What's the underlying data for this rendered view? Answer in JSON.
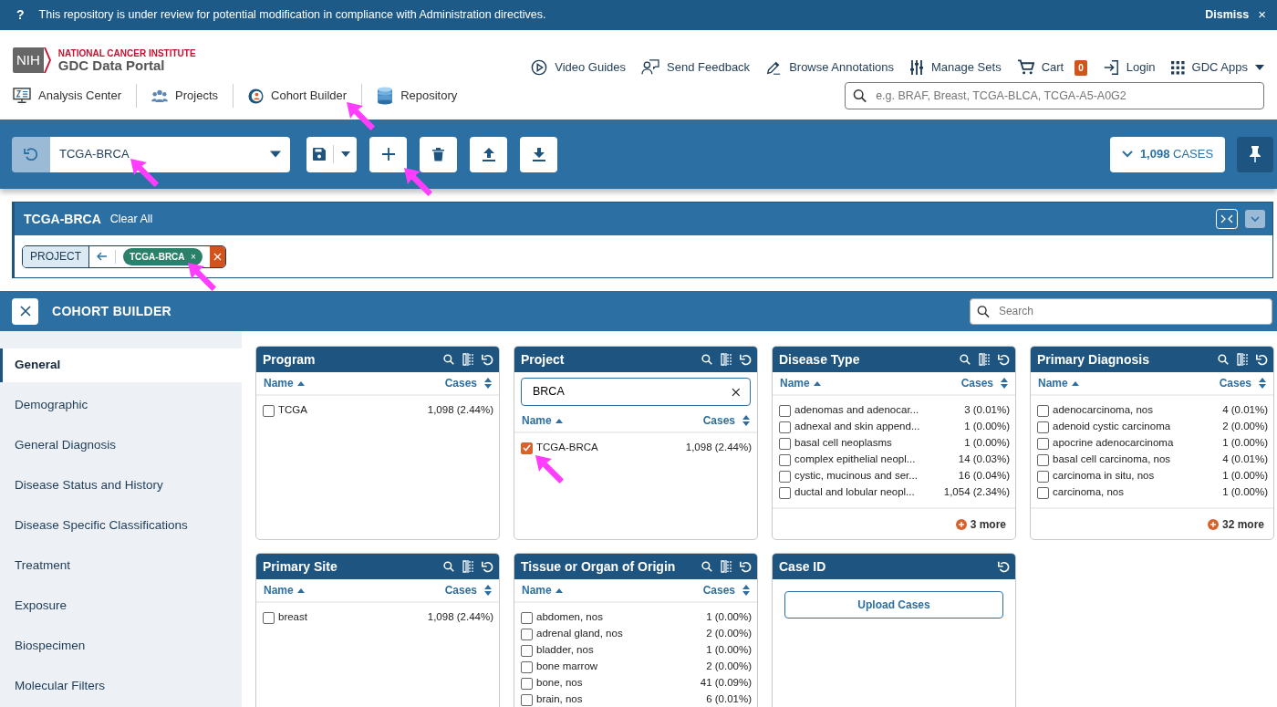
{
  "banner": {
    "icon": "?",
    "message": "This repository is under review for potential modification in compliance with Administration directives.",
    "dismiss": "Dismiss",
    "close": "×"
  },
  "logo": {
    "badge": "NIH",
    "institute": "NATIONAL CANCER INSTITUTE",
    "portal": "GDC Data Portal"
  },
  "top_links": [
    {
      "label": "Video Guides"
    },
    {
      "label": "Send Feedback"
    },
    {
      "label": "Browse Annotations"
    },
    {
      "label": "Manage Sets"
    },
    {
      "label": "Cart",
      "badge": "0"
    },
    {
      "label": "Login"
    },
    {
      "label": "GDC Apps"
    }
  ],
  "nav": [
    {
      "label": "Analysis Center"
    },
    {
      "label": "Projects"
    },
    {
      "label": "Cohort Builder"
    },
    {
      "label": "Repository"
    }
  ],
  "search": {
    "placeholder": "e.g. BRAF, Breast, TCGA-BLCA, TCGA-A5-A0G2"
  },
  "cohort_bar": {
    "name": "TCGA-BRCA",
    "cases_count": "1,098",
    "cases_label": "CASES"
  },
  "cohort_filters": {
    "title": "TCGA-BRCA",
    "clear": "Clear All",
    "filters": [
      {
        "field": "PROJECT",
        "values": [
          {
            "label": "TCGA-BRCA",
            "remove": "×"
          }
        ]
      }
    ]
  },
  "builder": {
    "title": "COHORT BUILDER",
    "search_placeholder": "Search",
    "tabs": [
      {
        "label": "General",
        "selected": true
      },
      {
        "label": "Demographic",
        "selected": false
      },
      {
        "label": "General Diagnosis",
        "selected": false
      },
      {
        "label": "Disease Status and History",
        "selected": false
      },
      {
        "label": "Disease Specific Classifications",
        "selected": false
      },
      {
        "label": "Treatment",
        "selected": false
      },
      {
        "label": "Exposure",
        "selected": false
      },
      {
        "label": "Biospecimen",
        "selected": false
      },
      {
        "label": "Molecular Filters",
        "selected": false
      }
    ],
    "cards": [
      {
        "title": "Program",
        "kind": "facet",
        "columns": [
          "Name",
          "Cases"
        ],
        "rows": [
          {
            "name": "TCGA",
            "cases": "1,098 (2.44%)",
            "checked": false
          }
        ]
      },
      {
        "title": "Project",
        "kind": "facet",
        "search_value": "BRCA",
        "columns": [
          "Name",
          "Cases"
        ],
        "rows": [
          {
            "name": "TCGA-BRCA",
            "cases": "1,098 (2.44%)",
            "checked": true
          }
        ]
      },
      {
        "title": "Disease Type",
        "kind": "facet",
        "columns": [
          "Name",
          "Cases"
        ],
        "more": "3 more",
        "rows": [
          {
            "name": "adenomas and adenocar...",
            "cases": "3 (0.01%)",
            "checked": false
          },
          {
            "name": "adnexal and skin append...",
            "cases": "1 (0.00%)",
            "checked": false
          },
          {
            "name": "basal cell neoplasms",
            "cases": "1 (0.00%)",
            "checked": false
          },
          {
            "name": "complex epithelial neopl...",
            "cases": "14 (0.03%)",
            "checked": false
          },
          {
            "name": "cystic, mucinous and ser...",
            "cases": "16 (0.04%)",
            "checked": false
          },
          {
            "name": "ductal and lobular neopl...",
            "cases": "1,054 (2.34%)",
            "checked": false
          }
        ]
      },
      {
        "title": "Primary Diagnosis",
        "kind": "facet",
        "columns": [
          "Name",
          "Cases"
        ],
        "more": "32 more",
        "rows": [
          {
            "name": "adenocarcinoma, nos",
            "cases": "4 (0.01%)",
            "checked": false
          },
          {
            "name": "adenoid cystic carcinoma",
            "cases": "2 (0.00%)",
            "checked": false
          },
          {
            "name": "apocrine adenocarcinoma",
            "cases": "1 (0.00%)",
            "checked": false
          },
          {
            "name": "basal cell carcinoma, nos",
            "cases": "4 (0.01%)",
            "checked": false
          },
          {
            "name": "carcinoma in situ, nos",
            "cases": "1 (0.00%)",
            "checked": false
          },
          {
            "name": "carcinoma, nos",
            "cases": "1 (0.00%)",
            "checked": false
          }
        ]
      },
      {
        "title": "Primary Site",
        "kind": "facet",
        "columns": [
          "Name",
          "Cases"
        ],
        "rows": [
          {
            "name": "breast",
            "cases": "1,098 (2.44%)",
            "checked": false
          }
        ]
      },
      {
        "title": "Tissue or Organ of Origin",
        "kind": "facet",
        "columns": [
          "Name",
          "Cases"
        ],
        "rows": [
          {
            "name": "abdomen, nos",
            "cases": "1 (0.00%)",
            "checked": false
          },
          {
            "name": "adrenal gland, nos",
            "cases": "2 (0.00%)",
            "checked": false
          },
          {
            "name": "bladder, nos",
            "cases": "1 (0.00%)",
            "checked": false
          },
          {
            "name": "bone marrow",
            "cases": "2 (0.00%)",
            "checked": false
          },
          {
            "name": "bone, nos",
            "cases": "41 (0.09%)",
            "checked": false
          },
          {
            "name": "brain, nos",
            "cases": "6 (0.01%)",
            "checked": false
          }
        ]
      },
      {
        "title": "Case ID",
        "kind": "upload",
        "button": "Upload Cases"
      }
    ]
  }
}
